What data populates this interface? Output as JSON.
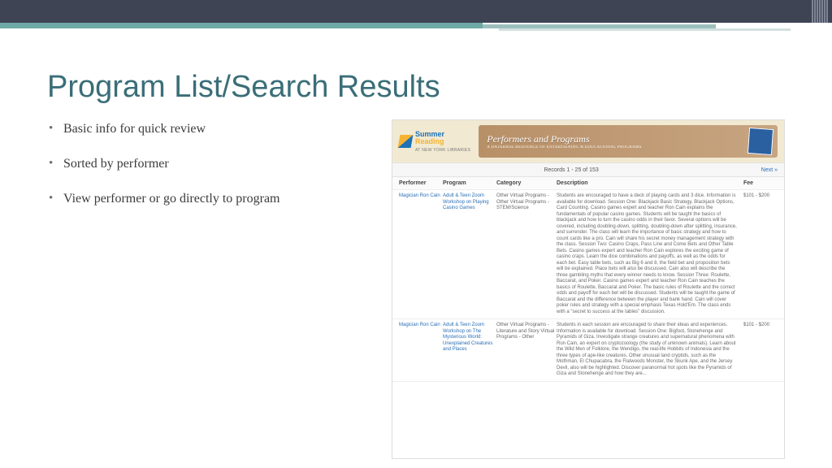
{
  "slide": {
    "title": "Program List/Search Results",
    "bullets": [
      "Basic info for quick review",
      "Sorted by performer",
      "View performer or go directly to program"
    ]
  },
  "screenshot": {
    "logo": {
      "line1": "Summer",
      "line2": "Reading",
      "line3": "AT NEW YORK LIBRARIES"
    },
    "banner": {
      "title": "Performers and Programs",
      "subtitle": "A DATABASE RESOURCE OF ENTERTAINING & EDUCATIONAL PROGRAMS"
    },
    "records_bar": {
      "count": "Records 1 - 25 of 153",
      "next": "Next »"
    },
    "columns": {
      "performer": "Performer",
      "program": "Program",
      "category": "Category",
      "description": "Description",
      "fee": "Fee"
    },
    "rows": [
      {
        "performer": "Magician Ron Cain",
        "program": "Adult & Teen Zoom Workshop on Playing Casino Games",
        "category": "Other\nVirtual Programs - Other\nVirtual Programs - STEM/Science",
        "description": "Students are encouraged to have a deck of playing cards and 3 dice. Information is available for download. Session One: Blackjack Basic Strategy, Blackjack Options, Card Counting. Casino games expert and teacher Ron Cain explains the fundamentals of popular casino games. Students will be taught the basics of blackjack and how to turn the casino odds in their favor. Several options will be covered, including doubling-down, splitting, doubling-down after splitting, insurance, and surrender. The class will learn the importance of basic strategy and how to count cards like a pro. Cain will share his secret money management strategy with the class. Session Two: Casino Craps, Pass Line and Come Bets and Other Table Bets. Casino games expert and teacher Ron Cain explores the exciting game of casino craps. Learn the dice combinations and payoffs, as well as the odds for each bet. Easy table bets, such as Big 6 and 8, the field bet and proposition bets will be explained. Place bets will also be discussed. Cain also will describe the three gambling myths that every winner needs to know. Session Three: Roulette, Baccarat, and Poker. Casino games expert and teacher Ron Cain teaches the basics of Roulette, Baccarat and Poker. The basic rules of Roulette and the correct odds and payoff for each bet will be discussed. Students will be taught the game of Baccarat and the difference between the player and bank hand. Cain will cover poker rules and strategy with a special emphasis Texas Hold'Em. The class ends with a \"secret to success at the tables\" discussion.",
        "fee": "$101 - $200"
      },
      {
        "performer": "Magician Ron Cain",
        "program": "Adult & Teen Zoom Workshop on The Mysterious World: Unexplained Creatures and Places",
        "category": "Other\nVirtual Programs - Literature and Story\nVirtual Programs - Other",
        "description": "Students in each session are encouraged to share their ideas and experiences. Information is available for download. Session One: Bigfoot, Stonehenge and Pyramids of Giza. Investigate strange creatures and supernatural phenomena with Ron Cain, an expert on cryptozoology (the study of unknown animals). Learn about the Wild Men of Folklore, the Wendigo, the real-life Hobbits of Indonesia and the three types of ape-like creatures. Other unusual land cryptids, such as the Mothman, El Chupacabra, the Flatwoods Monster, the Skunk Ape, and the Jersey Devil, also will be highlighted. Discover paranormal hot spots like the Pyramids of Giza and Stonehenge and how they are...",
        "fee": "$101 - $200"
      }
    ]
  }
}
